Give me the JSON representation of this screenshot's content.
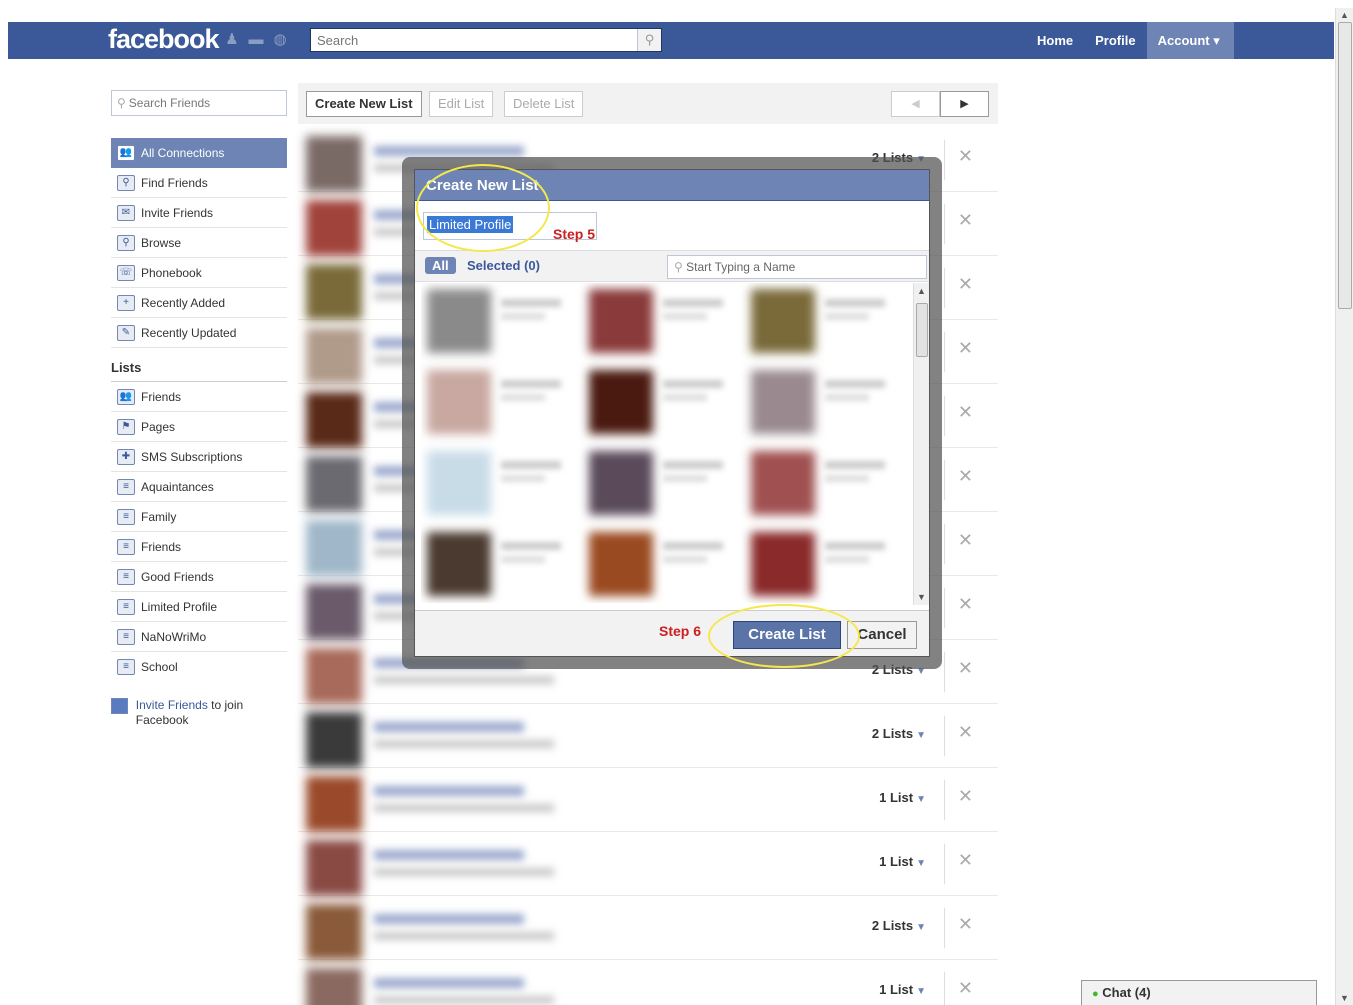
{
  "header": {
    "logo": "facebook",
    "search_placeholder": "Search",
    "nav": {
      "home": "Home",
      "profile": "Profile",
      "account": "Account ▾"
    }
  },
  "sidebar": {
    "search_placeholder": "Search Friends",
    "items": [
      {
        "label": "All Connections",
        "icon": "people-icon",
        "active": true
      },
      {
        "label": "Find Friends",
        "icon": "find-friends-icon"
      },
      {
        "label": "Invite Friends",
        "icon": "invite-icon"
      },
      {
        "label": "Browse",
        "icon": "magnifier-icon"
      },
      {
        "label": "Phonebook",
        "icon": "phone-icon"
      },
      {
        "label": "Recently Added",
        "icon": "recently-added-icon"
      },
      {
        "label": "Recently Updated",
        "icon": "pencil-icon"
      }
    ],
    "lists_heading": "Lists",
    "lists": [
      {
        "label": "Friends",
        "icon": "people-icon"
      },
      {
        "label": "Pages",
        "icon": "flag-icon"
      },
      {
        "label": "SMS Subscriptions",
        "icon": "sms-icon"
      },
      {
        "label": "Aquaintances",
        "icon": "list-icon"
      },
      {
        "label": "Family",
        "icon": "list-icon"
      },
      {
        "label": "Friends",
        "icon": "list-icon"
      },
      {
        "label": "Good Friends",
        "icon": "list-icon"
      },
      {
        "label": "Limited Profile",
        "icon": "list-icon"
      },
      {
        "label": "NaNoWriMo",
        "icon": "list-icon"
      },
      {
        "label": "School",
        "icon": "list-icon"
      }
    ],
    "invite_link": "Invite Friends",
    "invite_rest": " to join Facebook"
  },
  "toolbar": {
    "create": "Create New List",
    "edit": "Edit List",
    "delete": "Delete List",
    "prev": "◀",
    "next": "▶"
  },
  "rows": [
    {
      "lists": "2 Lists"
    },
    {
      "lists": ""
    },
    {
      "lists": ""
    },
    {
      "lists": ""
    },
    {
      "lists": ""
    },
    {
      "lists": ""
    },
    {
      "lists": ""
    },
    {
      "lists": ""
    },
    {
      "lists": "2 Lists"
    },
    {
      "lists": "2 Lists"
    },
    {
      "lists": "1 List"
    },
    {
      "lists": "1 List"
    },
    {
      "lists": "2 Lists"
    },
    {
      "lists": "1 List"
    }
  ],
  "dialog": {
    "title": "Create New List",
    "name_value": "Limited Profile",
    "step5": "Step 5",
    "step6": "Step 6",
    "all_chip": "All",
    "selected": "Selected (0)",
    "typer_placeholder": "Start Typing a Name",
    "create_btn": "Create List",
    "cancel_btn": "Cancel"
  },
  "chat": {
    "label": "Chat (4)"
  },
  "colors": {
    "brand": "#3b5998",
    "brand_light": "#6d84b4",
    "annotation": "#f4e84a",
    "step_text": "#cc1f1f"
  }
}
